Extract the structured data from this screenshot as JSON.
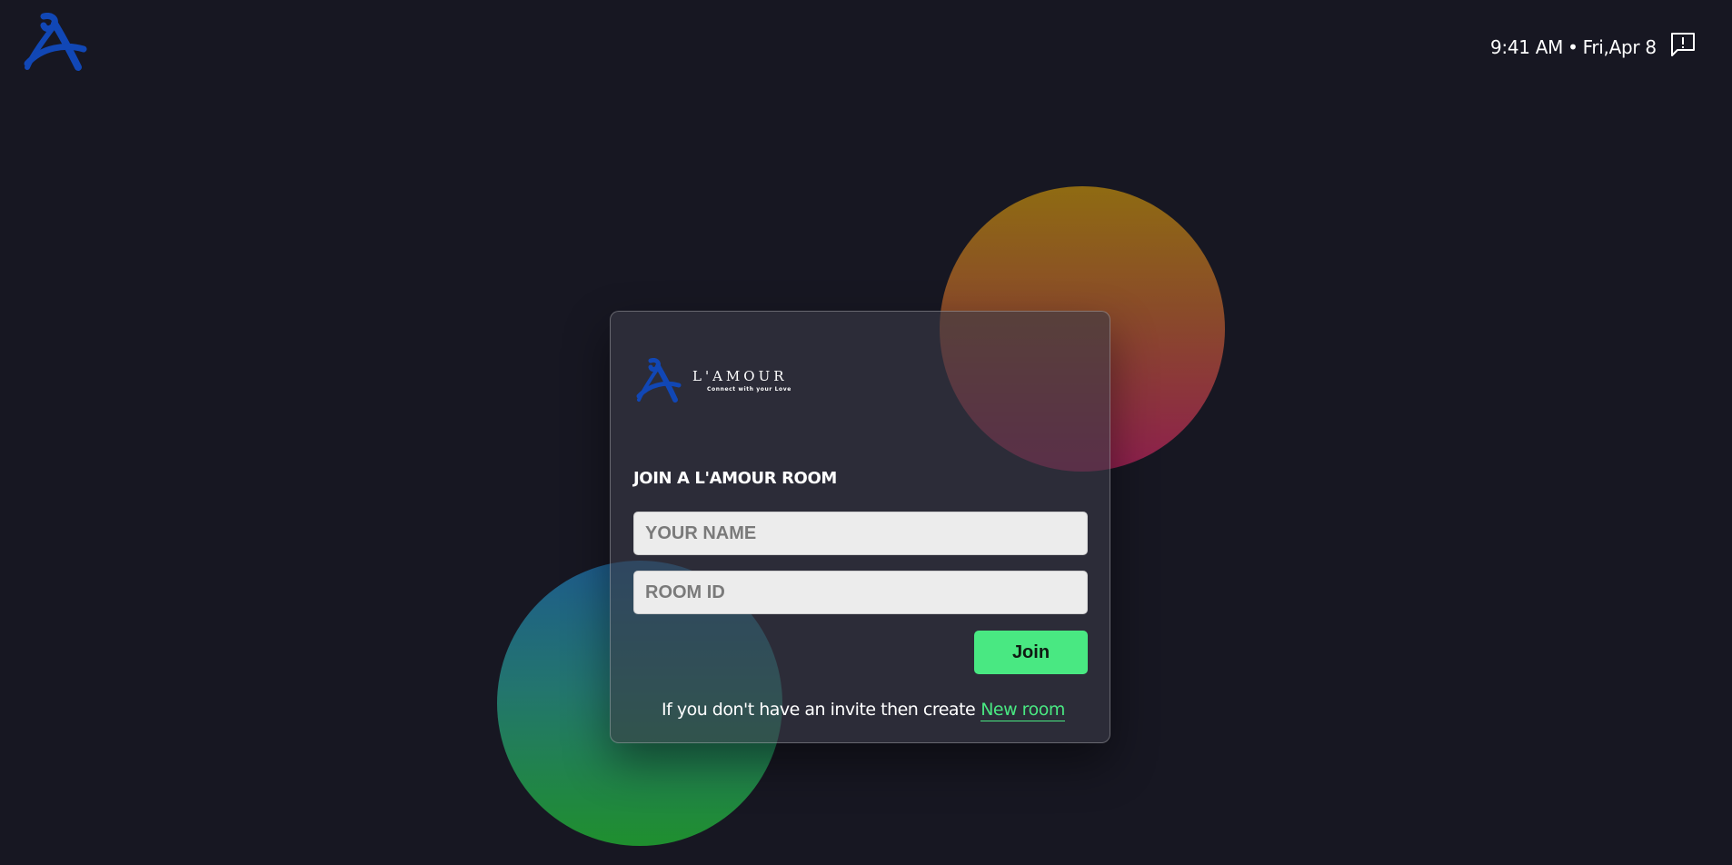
{
  "header": {
    "logo_icon": "lamour-a-logo-icon",
    "time": "9:41 AM",
    "separator": "•",
    "date": "Fri,Apr 8",
    "feedback_icon": "feedback-alert-icon"
  },
  "card": {
    "brand": {
      "name": "L'AMOUR",
      "tagline": "Connect with your Love"
    },
    "title": "JOIN A L'AMOUR ROOM",
    "name_input": {
      "placeholder": "YOUR NAME",
      "value": ""
    },
    "room_input": {
      "placeholder": "ROOM ID",
      "value": ""
    },
    "join_label": "Join",
    "invite_text": "If you don't have an invite then create",
    "new_room_label": "New room"
  },
  "colors": {
    "background": "#171722",
    "accent_green": "#49e882",
    "logo_blue": "#1147b5",
    "warm_orb_top": "#8f6b12",
    "warm_orb_bottom": "#8e1f4e",
    "cool_orb_top": "#1e5c8c",
    "cool_orb_bottom": "#1f8f2e"
  }
}
